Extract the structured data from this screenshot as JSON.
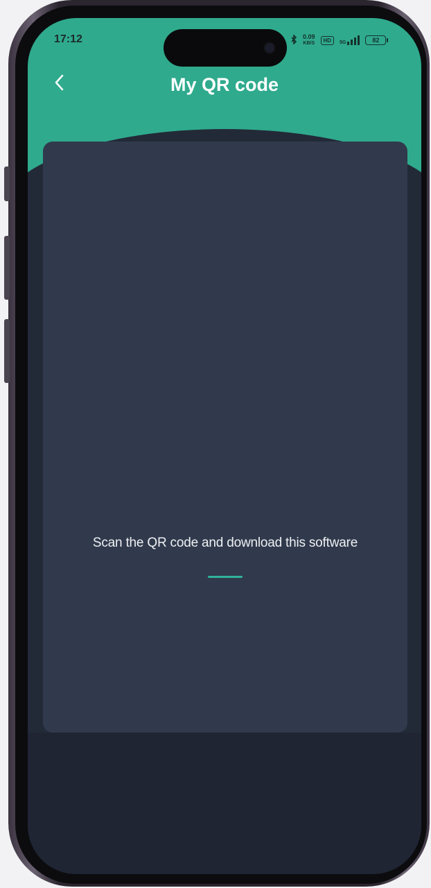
{
  "status_bar": {
    "time": "17:12",
    "net_speed_value": "0.09",
    "net_speed_unit": "KB/S",
    "hd_label": "HD",
    "signal_label": "5G",
    "battery": "82"
  },
  "header": {
    "title": "My QR code",
    "back_icon": "chevron-left-icon"
  },
  "card": {
    "caption": "Scan the QR code and download this software"
  },
  "colors": {
    "header": "#2faa8d",
    "background": "#222a38",
    "card": "#313a4c",
    "accent": "#2fb39a"
  }
}
